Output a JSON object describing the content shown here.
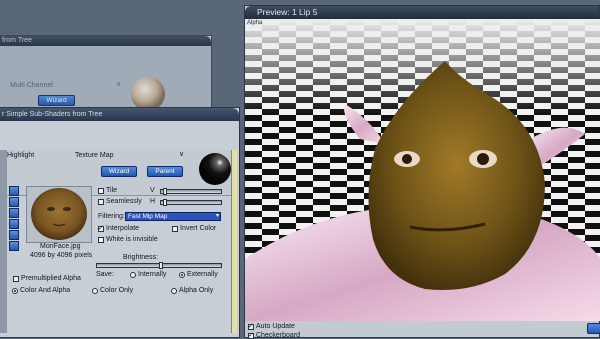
{
  "back_window": {
    "title": "from Tree",
    "multi_channel_label": "Multi Channel",
    "wizard_label": "Wizard"
  },
  "shader_window": {
    "title": "r Simple Sub-Shaders from Tree",
    "highlight_label": "Highlight",
    "texture_map_label": "Texture Map",
    "wizard_label": "Wizard",
    "parent_label": "Parent",
    "tile_label": "Tile",
    "v_label": "V",
    "seamlessly_label": "Seamlessly",
    "h_label": "H",
    "filtering_label": "Filtering:",
    "filtering_value": "Fast Mip Map",
    "interpolate_label": "Interpolate",
    "invert_color_label": "Invert Color",
    "white_invisible_label": "White is invisible",
    "brightness_label": "Brightness:",
    "brightness_level": 0.52,
    "texture_name": "MonFace.jpg",
    "texture_size": "4096 by 4096 pixels",
    "premultiplied_label": "Premultiplied Alpha",
    "save_label": "Save:",
    "internally_label": "Internally",
    "externally_label": "Externally",
    "color_alpha_label": "Color And Alpha",
    "color_only_label": "Color Only",
    "alpha_only_label": "Alpha Only"
  },
  "preview_window": {
    "title": "Preview: 1  Lip 5",
    "corner_text": "Alpha",
    "auto_update_label": "Auto Update",
    "checkerboard_label": "Checkerboard"
  },
  "colors": {
    "accent_blue": "#2b55b8",
    "skin": "#8a6a1c",
    "background": "#5a6778"
  }
}
